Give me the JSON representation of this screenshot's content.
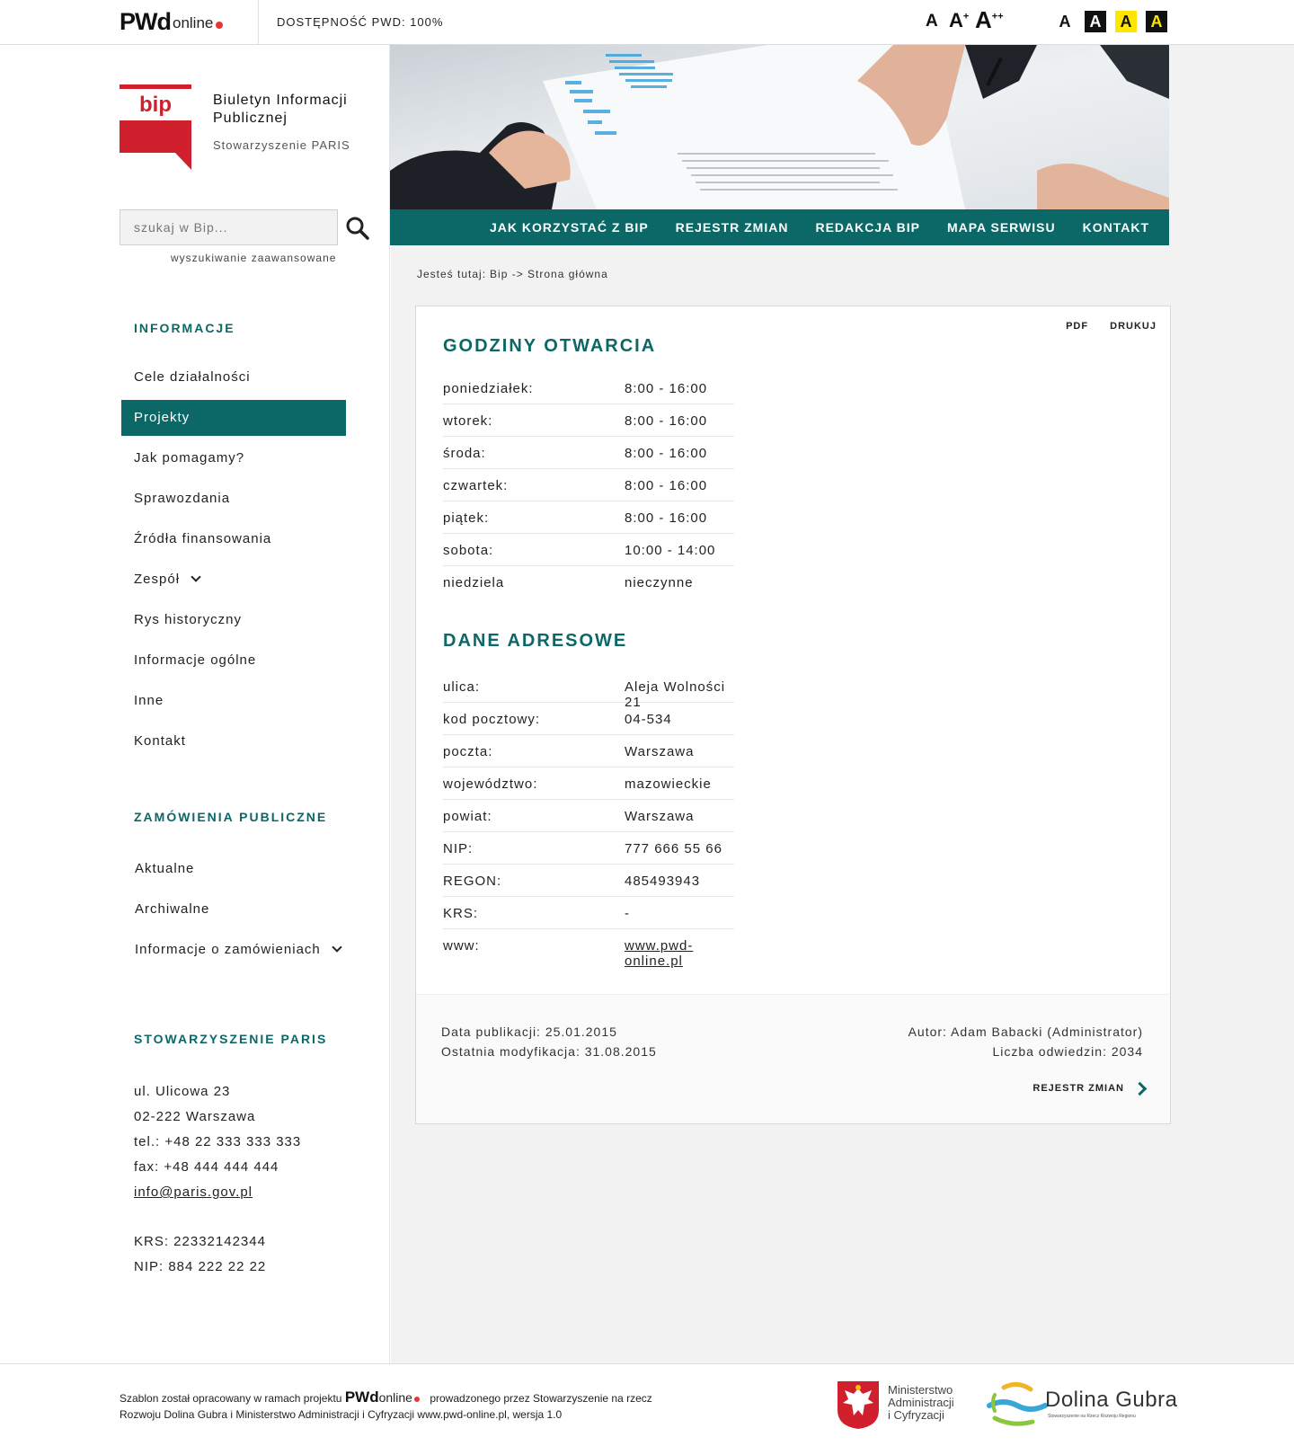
{
  "topbar": {
    "logo_pwd": "PWd",
    "logo_online": "online",
    "accessibility": "DOSTĘPNOŚĆ PWD: 100%",
    "font_sizes": [
      "A",
      "A",
      "A"
    ],
    "font_sups": [
      "",
      "+",
      "++"
    ],
    "contrast": [
      "A",
      "A",
      "A",
      "A"
    ]
  },
  "sidebar": {
    "bip_logo_text": "bip",
    "title": "Biuletyn Informacji Publicznej",
    "subtitle": "Stowarzyszenie PARIS",
    "search_placeholder": "szukaj w Bip...",
    "advanced_search": "wyszukiwanie zaawansowane",
    "sections": [
      {
        "title": "INFORMACJE",
        "items": [
          {
            "label": "Cele działalności",
            "active": false,
            "submenu": false
          },
          {
            "label": "Projekty",
            "active": true,
            "submenu": false
          },
          {
            "label": "Jak pomagamy?",
            "active": false,
            "submenu": false
          },
          {
            "label": "Sprawozdania",
            "active": false,
            "submenu": false
          },
          {
            "label": "Źródła finansowania",
            "active": false,
            "submenu": false
          },
          {
            "label": "Zespół",
            "active": false,
            "submenu": true
          },
          {
            "label": "Rys historyczny",
            "active": false,
            "submenu": false
          },
          {
            "label": "Informacje ogólne",
            "active": false,
            "submenu": false
          },
          {
            "label": "Inne",
            "active": false,
            "submenu": false
          },
          {
            "label": "Kontakt",
            "active": false,
            "submenu": false
          }
        ]
      },
      {
        "title": "ZAMÓWIENIA PUBLICZNE",
        "items": [
          {
            "label": "Aktualne",
            "active": false,
            "submenu": false
          },
          {
            "label": "Archiwalne",
            "active": false,
            "submenu": false
          },
          {
            "label": "Informacje o zamówieniach",
            "active": false,
            "submenu": true
          }
        ]
      }
    ],
    "org": {
      "title": "STOWARZYSZENIE PARIS",
      "street": "ul. Ulicowa 23",
      "city": "02-222 Warszawa",
      "tel": "tel.: +48 22 333 333 333",
      "fax": "fax: +48 444 444 444",
      "email": "info@paris.gov.pl",
      "krs": "KRS: 22332142344",
      "nip": "NIP: 884 222 22 22"
    }
  },
  "nav": [
    "JAK KORZYSTAĆ Z BIP",
    "REJESTR ZMIAN",
    "REDAKCJA BIP",
    "MAPA SERWISU",
    "KONTAKT"
  ],
  "breadcrumb": {
    "prefix": "Jesteś tutaj:",
    "path": "Bip -> Strona główna"
  },
  "card": {
    "pdf": "PDF",
    "print": "DRUKUJ",
    "hours_title": "GODZINY OTWARCIA",
    "hours": [
      {
        "k": "poniedziałek:",
        "v": "8:00 - 16:00"
      },
      {
        "k": "wtorek:",
        "v": "8:00 - 16:00"
      },
      {
        "k": "środa:",
        "v": "8:00 - 16:00"
      },
      {
        "k": "czwartek:",
        "v": "8:00 - 16:00"
      },
      {
        "k": "piątek:",
        "v": "8:00 - 16:00"
      },
      {
        "k": "sobota:",
        "v": "10:00 - 14:00"
      },
      {
        "k": "niedziela",
        "v": "nieczynne"
      }
    ],
    "address_title": "DANE ADRESOWE",
    "address": [
      {
        "k": "ulica:",
        "v": "Aleja Wolności 21"
      },
      {
        "k": "kod pocztowy:",
        "v": "04-534"
      },
      {
        "k": "poczta:",
        "v": "Warszawa"
      },
      {
        "k": "województwo:",
        "v": "mazowieckie"
      },
      {
        "k": "powiat:",
        "v": "Warszawa"
      },
      {
        "k": "NIP:",
        "v": "777 666 55 66"
      },
      {
        "k": "REGON:",
        "v": "485493943"
      },
      {
        "k": "KRS:",
        "v": "-"
      },
      {
        "k": "www:",
        "v": "www.pwd-online.pl"
      }
    ],
    "published": "Data publikacji: 25.01.2015",
    "modified": "Ostatnia modyfikacja: 31.08.2015",
    "author": "Autor: Adam Babacki (Administrator)",
    "visits": "Liczba odwiedzin: 2034",
    "changes_link": "REJESTR ZMIAN"
  },
  "footer": {
    "text_a": "Szablon został opracowany w ramach projektu",
    "logo_pwd": "PWd",
    "logo_online": "online",
    "text_b": "prowadzonego przez Stowarzyszenie na rzecz",
    "text_c": "Rozwoju Dolina Gubra i Ministerstwo Administracji i Cyfryzacji www.pwd-online.pl, wersja 1.0",
    "ministry": [
      "Ministerstwo",
      "Administracji",
      "i Cyfryzacji"
    ],
    "dg_name": "Dolina Gubra",
    "dg_sub": "Stowarzyszenie na Rzecz Rozwoju Regionu"
  },
  "colors": {
    "accent": "#0b6866",
    "brand_red": "#d0202e",
    "highlight": "#ffe600"
  }
}
